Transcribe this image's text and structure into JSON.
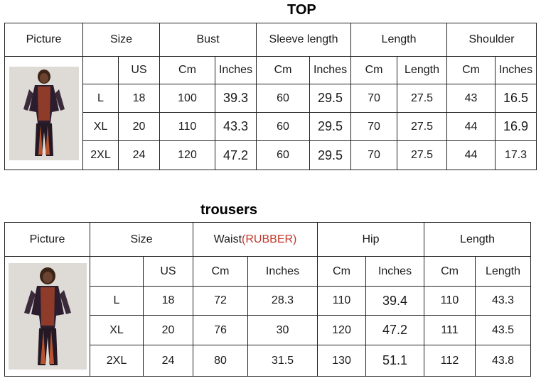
{
  "top": {
    "title": "TOP",
    "headers": [
      "Picture",
      "Size",
      "Bust",
      "Sleeve length",
      "Length",
      "Shoulder"
    ],
    "subheaders": [
      "US",
      "Cm",
      "Inches",
      "Cm",
      "Inches",
      "Cm",
      "Length",
      "Cm",
      "Inches"
    ],
    "rows": [
      [
        "L",
        "18",
        "100",
        "39.3",
        "60",
        "29.5",
        "70",
        "27.5",
        "43",
        "16.5"
      ],
      [
        "XL",
        "20",
        "110",
        "43.3",
        "60",
        "29.5",
        "70",
        "27.5",
        "44",
        "16.9"
      ],
      [
        "2XL",
        "24",
        "120",
        "47.2",
        "60",
        "29.5",
        "70",
        "27.5",
        "44",
        "17.3"
      ]
    ]
  },
  "trousers": {
    "title": "trousers",
    "headers": [
      "Picture",
      "Size",
      "Waist",
      "Hip",
      "Length"
    ],
    "waist_note": "(RUBBER)",
    "subheaders": [
      "US",
      "Cm",
      "Inches",
      "Cm",
      "Inches",
      "Cm",
      "Length"
    ],
    "rows": [
      [
        "L",
        "18",
        "72",
        "28.3",
        "110",
        "39.4",
        "110",
        "43.3"
      ],
      [
        "XL",
        "20",
        "76",
        "30",
        "120",
        "47.2",
        "111",
        "43.5"
      ],
      [
        "2XL",
        "24",
        "80",
        "31.5",
        "130",
        "51.1",
        "112",
        "43.8"
      ]
    ]
  },
  "colors": {
    "accent": "#c0392b",
    "border": "#222222"
  }
}
